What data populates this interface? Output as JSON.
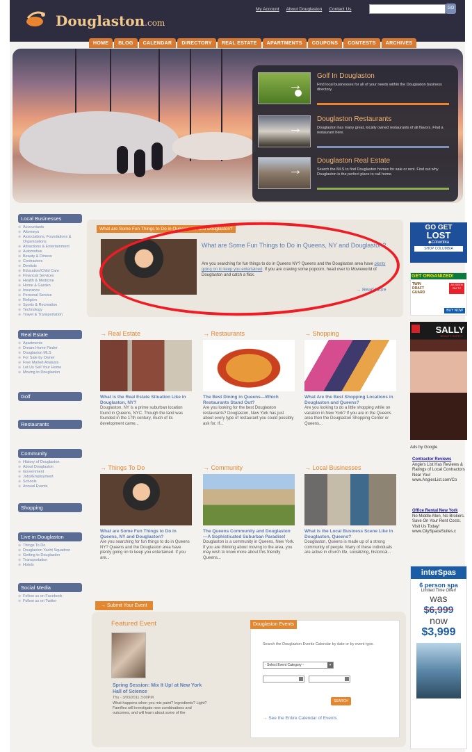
{
  "header": {
    "logo_main": "Douglaston",
    "logo_suffix": ".com",
    "links": [
      "My Account",
      "About Douglaston",
      "Contact Us"
    ],
    "search_button": "GO"
  },
  "nav": [
    "HOME",
    "BLOG",
    "CALENDAR",
    "DIRECTORY",
    "REAL ESTATE",
    "APARTMENTS",
    "COUPONS",
    "CONTESTS",
    "ARCHIVES"
  ],
  "promos": [
    {
      "title": "Golf In Douglaston",
      "desc": "Find local businesses for all of your needs within the Douglaston business directory.",
      "bar": "#e8852e"
    },
    {
      "title": "Douglaston Restaurants",
      "desc": "Douglaston has many great, locally owned restaurants of all flavors. Find a restaurant here.",
      "bar": "#7f93b8"
    },
    {
      "title": "Douglaston Real Estate",
      "desc": "Search the MLS to find Douglaston homes for sale or rent. Find out why Douglaston is the perfect place to call home.",
      "bar": "#8fb04c"
    }
  ],
  "sidebar": {
    "local_businesses": {
      "title": "Local Businesses",
      "items": [
        "Accountants",
        "Attorneys",
        "Associations, Foundations & Organizations",
        "Attractions & Entertainment",
        "Automotive",
        "Beauty & Fitness",
        "Contractors",
        "Dentists",
        "Education/Child Care",
        "Financial Services",
        "Health & Medicine",
        "Home & Garden",
        "Insurance",
        "Personal Service",
        "Religion",
        "Sports & Recreation",
        "Technology",
        "Travel & Transportation"
      ]
    },
    "real_estate": {
      "title": "Real Estate",
      "items": [
        "Apartments",
        "Dream Home Finder",
        "Douglaston MLS",
        "For Sale by Owner",
        "Free Market Analysis",
        "Let Us Sell Your Home",
        "Moving to Douglaston"
      ]
    },
    "golf": "Golf",
    "restaurants": "Restaurants",
    "community": {
      "title": "Community",
      "items": [
        "History of Douglaston",
        "About Douglaston",
        "Government",
        "Jobs/Employment",
        "Schools",
        "Annual Events"
      ]
    },
    "shopping": "Shopping",
    "live": {
      "title": "Live in Douglaston",
      "items": [
        "Things To Do",
        "Douglaston Yacht Squadron",
        "Getting to Douglaston",
        "Transportation",
        "Hotels"
      ]
    },
    "social": {
      "title": "Social Media",
      "items": [
        "Follow us on Facebook",
        "Follow us on Twitter"
      ]
    }
  },
  "feature": {
    "tab": "What are Some Fun Things to Do in Queens, NY and Douglaston?",
    "title": "What are Some Fun Things to Do in Queens, NY and Douglaston?",
    "text_before": "Are you searching for fun things to do in Queens NY? Queens and the Douglaston area have ",
    "link": "plenty going on to keep you entertained",
    "text_after": ". If you are craving some popcorn, head over to Movieworld of Douglaston and catch a flick.",
    "more": "Read More"
  },
  "cards": [
    {
      "head": "Real Estate",
      "title": "What is the Real Estate Situation Like in Douglaston, NY?",
      "text": "Douglaston, NY is a prime suburban location found in Queens, NYC. Though the land was founded in the 17th century, much of its development came..."
    },
    {
      "head": "Restaurants",
      "title": "The Best Dining in Queens—Which Restaurants Stand Out?",
      "text": "Are you looking for the best Douglaston restaurants? Douglaston, New York has just about every type of restaurant you could possibly ask for. If..."
    },
    {
      "head": "Shopping",
      "title": "What Are the Best Shopping Locations in Douglaston and Queens?",
      "text": "Are you looking to do a little shopping while on vacation in New York? If you are in the Queens area then the Douglaston Shopping Center or Queens..."
    },
    {
      "head": "Things To Do",
      "title": "What are Some Fun Things to Do in Queens, NY and Douglaston?",
      "text": "Are you searching for fun things to do in Queens NY? Queens and the Douglaston area have plenty going on to keep you entertained. If you are..."
    },
    {
      "head": "Community",
      "title": "The Queens Community and Douglaston—A Sophisticated Suburban Paradise!",
      "text": "Douglaston is a community in Queens, New York. If you are thinking about moving to the area, you may wish to know more about this friendly Queens..."
    },
    {
      "head": "Local Businesses",
      "title": "What is the Local Business Scene Like in Douglaston, Queens?",
      "text": "Douglaston, Queens is made up of a strong community of people. Many of these individuals are active in church life, socializing, historical..."
    }
  ],
  "events": {
    "submit": "Submit Your Event",
    "featured_title": "Featured Event",
    "event_name": "Spring Session: Mix It Up! at New York Hall of Science",
    "event_date": "Thu - 3/03/2011 3:00PM",
    "event_desc": "What happens when you mix paint? Ingredients? Light? Families will investigate new combinations and outcomes, and will learn about some of the",
    "panel_title": "Douglaston Events",
    "panel_text": "Search the Douglaston Events Calendar by date or by event type.",
    "select": "- Select Event Category -",
    "search_btn": "SEARCH",
    "calendar_link": "See the Entire Calendar of Events"
  },
  "ads": {
    "columbia1": "GO GET",
    "columbia2": "LOST",
    "columbia3": "Columbia",
    "columbia4": "SHOP COLUMBIA",
    "organized": "GET ORGANIZED!",
    "twin": "TWIN DRAFT GUARD",
    "asseen": "AS SEEN ON TV",
    "buynow": "BUY NOW",
    "sally": "SALLY",
    "sally_sub": "BEAUTY SUPPLY",
    "google": "Ads by Google",
    "ad1_title": "Contractor Reviews",
    "ad1_text": "Angie's List Has Reviews & Ratings of Local Contractors Near You!",
    "ad1_url": "www.AngiesList.com/Co",
    "ad2_title": "Office Rental New York",
    "ad2_text": "No Middle-Men, No Brokers. Save On Your Rent Costs. Visit Us Today!",
    "ad2_url": "www.CitySpaceSuites.c",
    "spa1": "interSpas",
    "spa2": "6 person spa",
    "spa3": "Limited Time Offer!",
    "was": "was",
    "old_price": "$6,999",
    "now": "now",
    "new_price": "$3,999"
  }
}
